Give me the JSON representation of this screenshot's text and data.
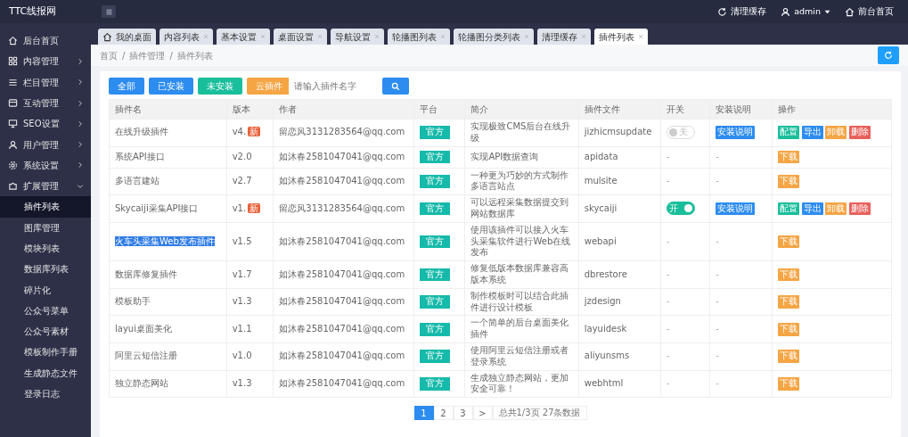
{
  "header": {
    "logo": "TTC线报网",
    "actions": [
      {
        "kind": "refresh",
        "label": "清理缓存"
      },
      {
        "kind": "user",
        "label": "admin"
      },
      {
        "kind": "home",
        "label": "前台首页"
      }
    ]
  },
  "sidebar": {
    "items": [
      {
        "label": "后台首页"
      },
      {
        "label": "内容管理",
        "expanded": false
      },
      {
        "label": "栏目管理",
        "expanded": false
      },
      {
        "label": "互动管理",
        "expanded": false
      },
      {
        "label": "SEO设置",
        "expanded": false
      },
      {
        "label": "用户管理",
        "expanded": false
      },
      {
        "label": "系统设置",
        "expanded": false
      },
      {
        "label": "扩展管理",
        "expanded": true,
        "children": [
          {
            "label": "插件列表",
            "selected": true
          },
          {
            "label": "图库管理",
            "selected": false
          },
          {
            "label": "模块列表",
            "selected": false
          },
          {
            "label": "数据库列表",
            "selected": false
          },
          {
            "label": "碎片化",
            "selected": false
          },
          {
            "label": "公众号菜单",
            "selected": false
          },
          {
            "label": "公众号素材",
            "selected": false
          },
          {
            "label": "模板制作手册",
            "selected": false
          },
          {
            "label": "生成静态文件",
            "selected": false
          },
          {
            "label": "登录日志",
            "selected": false
          }
        ]
      }
    ]
  },
  "tabs": [
    {
      "label": "我的桌面",
      "home": true,
      "selected": false
    },
    {
      "label": "内容列表",
      "selected": false
    },
    {
      "label": "基本设置",
      "selected": false
    },
    {
      "label": "桌面设置",
      "selected": false
    },
    {
      "label": "导航设置",
      "selected": false
    },
    {
      "label": "轮播图列表",
      "selected": false
    },
    {
      "label": "轮播图分类列表",
      "selected": false
    },
    {
      "label": "清理缓存",
      "selected": false
    },
    {
      "label": "插件列表",
      "selected": true
    }
  ],
  "breadcrumb": {
    "separator": "/",
    "items": [
      "首页",
      "插件管理",
      "插件列表"
    ]
  },
  "filters": [
    {
      "label": "全部",
      "kind": "blue"
    },
    {
      "label": "已安装",
      "kind": "blue"
    },
    {
      "label": "未安装",
      "kind": "teal"
    },
    {
      "label": "云插件",
      "kind": "orange"
    }
  ],
  "search": {
    "placeholder": "请输入插件名字"
  },
  "table": {
    "columns": [
      "插件名",
      "版本",
      "作者",
      "平台",
      "简介",
      "插件文件",
      "开关",
      "安装说明",
      "操作"
    ],
    "rows": [
      {
        "kind": "installed",
        "name": "在线升级插件",
        "selected": false,
        "version": "v4.",
        "new_badge": "新",
        "author": "留恋风3131283564@qq.com",
        "platform": "官方",
        "intro": "实现极致CMS后台在线升级",
        "file": "jizhicmsupdate",
        "switch": {
          "on": false,
          "label": "关"
        },
        "doc": "安装说明",
        "actions": [
          {
            "kind": "config",
            "label": "配置"
          },
          {
            "kind": "export",
            "label": "导出"
          },
          {
            "kind": "uninstall",
            "label": "卸载"
          },
          {
            "kind": "delete",
            "label": "删除"
          }
        ]
      },
      {
        "kind": "available",
        "name": "系统API接口",
        "selected": false,
        "version": "v2.0",
        "author": "如沐春2581047041@qq.com",
        "platform": "官方",
        "intro": "实现API数据查询",
        "file": "apidata",
        "switch_text": "-",
        "doc_text": "-",
        "actions": [
          {
            "kind": "download",
            "label": "下载"
          }
        ]
      },
      {
        "kind": "available",
        "name": "多语言建站",
        "selected": false,
        "version": "v2.7",
        "author": "如沐春2581047041@qq.com",
        "platform": "官方",
        "intro": "一种更为巧妙的方式制作多语言站点",
        "file": "mulsite",
        "switch_text": "-",
        "doc_text": "-",
        "actions": [
          {
            "kind": "download",
            "label": "下载"
          }
        ]
      },
      {
        "kind": "installed",
        "name": "Skycaiji采集API接口",
        "selected": false,
        "version": "v1.",
        "new_badge": "新",
        "author": "留恋风3131283564@qq.com",
        "platform": "官方",
        "intro": "可以远程采集数据提交到网站数据库",
        "file": "skycaiji",
        "switch": {
          "on": true,
          "label": "开"
        },
        "doc": "安装说明",
        "actions": [
          {
            "kind": "config",
            "label": "配置"
          },
          {
            "kind": "export",
            "label": "导出"
          },
          {
            "kind": "uninstall",
            "label": "卸载"
          },
          {
            "kind": "delete",
            "label": "删除"
          }
        ]
      },
      {
        "kind": "available",
        "name": "火车头采集Web发布插件",
        "selected": true,
        "version": "v1.5",
        "author": "如沐春2581047041@qq.com",
        "platform": "官方",
        "intro": "使用该插件可以接入火车头采集软件进行Web在线发布",
        "file": "webapi",
        "switch_text": "-",
        "doc_text": "-",
        "actions": [
          {
            "kind": "download",
            "label": "下载"
          }
        ]
      },
      {
        "kind": "available",
        "name": "数据库修复插件",
        "selected": false,
        "version": "v1.7",
        "author": "如沐春2581047041@qq.com",
        "platform": "官方",
        "intro": "修复低版本数据库兼容高版本系统",
        "file": "dbrestore",
        "switch_text": "-",
        "doc_text": "-",
        "actions": [
          {
            "kind": "download",
            "label": "下载"
          }
        ]
      },
      {
        "kind": "available",
        "name": "模板助手",
        "selected": false,
        "version": "v1.3",
        "author": "如沐春2581047041@qq.com",
        "platform": "官方",
        "intro": "制作模板时可以结合此插件进行设计模板",
        "file": "jzdesign",
        "switch_text": "-",
        "doc_text": "-",
        "actions": [
          {
            "kind": "download",
            "label": "下载"
          }
        ]
      },
      {
        "kind": "available",
        "name": "layui桌面美化",
        "selected": false,
        "version": "v1.1",
        "author": "如沐春2581047041@qq.com",
        "platform": "官方",
        "intro": "一个简单的后台桌面美化插件",
        "file": "layuidesk",
        "switch_text": "-",
        "doc_text": "-",
        "actions": [
          {
            "kind": "download",
            "label": "下载"
          }
        ]
      },
      {
        "kind": "available",
        "name": "阿里云短信注册",
        "selected": false,
        "version": "v1.0",
        "author": "如沐春2581047041@qq.com",
        "platform": "官方",
        "intro": "使用阿里云短信注册或者登录系统",
        "file": "aliyunsms",
        "switch_text": "-",
        "doc_text": "-",
        "actions": [
          {
            "kind": "download",
            "label": "下载"
          }
        ]
      },
      {
        "kind": "available",
        "name": "独立静态网站",
        "selected": false,
        "version": "v1.3",
        "author": "如沐春2581047041@qq.com",
        "platform": "官方",
        "intro": "生成独立静态网站，更加安全可靠！",
        "file": "webhtml",
        "switch_text": "-",
        "doc_text": "-",
        "actions": [
          {
            "kind": "download",
            "label": "下载"
          }
        ]
      }
    ]
  },
  "pagination": {
    "pages": [
      {
        "label": "1",
        "selected": true
      },
      {
        "label": "2",
        "selected": false
      },
      {
        "label": "3",
        "selected": false
      },
      {
        "label": ">",
        "selected": false
      }
    ],
    "summary": "总共1/3页 27条数据"
  }
}
